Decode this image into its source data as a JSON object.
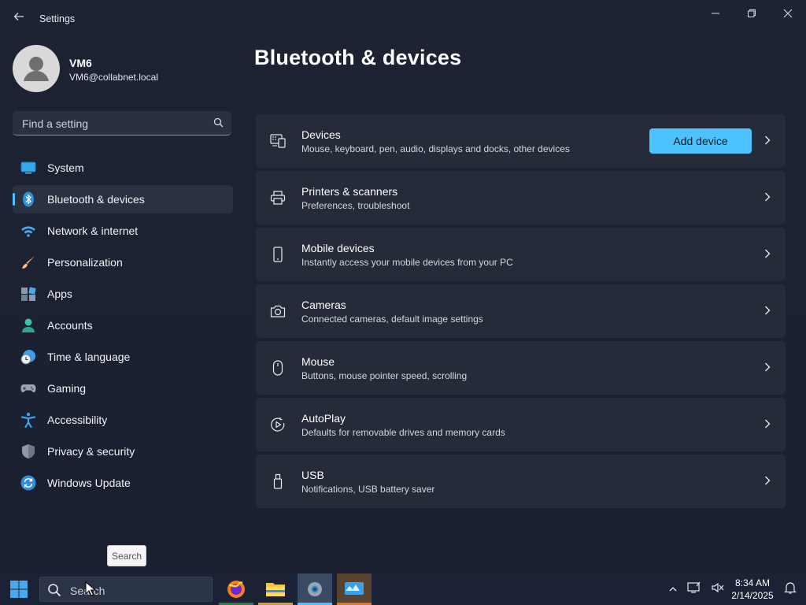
{
  "window": {
    "title": "Settings",
    "controls": [
      "minimize-icon",
      "restore-icon",
      "close-icon"
    ]
  },
  "profile": {
    "name": "VM6",
    "email": "VM6@collabnet.local"
  },
  "search": {
    "placeholder": "Find a setting"
  },
  "sidebar": {
    "items": [
      {
        "label": "System",
        "icon": "system-icon"
      },
      {
        "label": "Bluetooth & devices",
        "icon": "bluetooth-icon",
        "active": true
      },
      {
        "label": "Network & internet",
        "icon": "wifi-icon"
      },
      {
        "label": "Personalization",
        "icon": "brush-icon"
      },
      {
        "label": "Apps",
        "icon": "apps-icon"
      },
      {
        "label": "Accounts",
        "icon": "accounts-icon"
      },
      {
        "label": "Time & language",
        "icon": "clock-globe-icon"
      },
      {
        "label": "Gaming",
        "icon": "gamepad-icon"
      },
      {
        "label": "Accessibility",
        "icon": "accessibility-icon"
      },
      {
        "label": "Privacy & security",
        "icon": "shield-icon"
      },
      {
        "label": "Windows Update",
        "icon": "update-icon"
      }
    ]
  },
  "main": {
    "title": "Bluetooth & devices",
    "add_device_label": "Add device",
    "cards": [
      {
        "title": "Devices",
        "subtitle": "Mouse, keyboard, pen, audio, displays and docks, other devices",
        "icon": "devices-icon"
      },
      {
        "title": "Printers & scanners",
        "subtitle": "Preferences, troubleshoot",
        "icon": "printer-icon"
      },
      {
        "title": "Mobile devices",
        "subtitle": "Instantly access your mobile devices from your PC",
        "icon": "phone-icon"
      },
      {
        "title": "Cameras",
        "subtitle": "Connected cameras, default image settings",
        "icon": "camera-icon"
      },
      {
        "title": "Mouse",
        "subtitle": "Buttons, mouse pointer speed, scrolling",
        "icon": "mouse-icon"
      },
      {
        "title": "AutoPlay",
        "subtitle": "Defaults for removable drives and memory cards",
        "icon": "autoplay-icon"
      },
      {
        "title": "USB",
        "subtitle": "Notifications, USB battery saver",
        "icon": "usb-icon"
      }
    ]
  },
  "tooltip": {
    "text": "Search"
  },
  "taskbar": {
    "search_placeholder": "Search",
    "apps": [
      "firefox-icon",
      "file-explorer-icon",
      "settings-app-icon",
      "app-icon"
    ],
    "time": "8:34 AM",
    "date": "2/14/2025"
  },
  "colors": {
    "accent": "#4cc2ff",
    "window_bg": "#1d2332",
    "card_bg": "#252b39",
    "taskbar_bg": "#1b2235"
  }
}
